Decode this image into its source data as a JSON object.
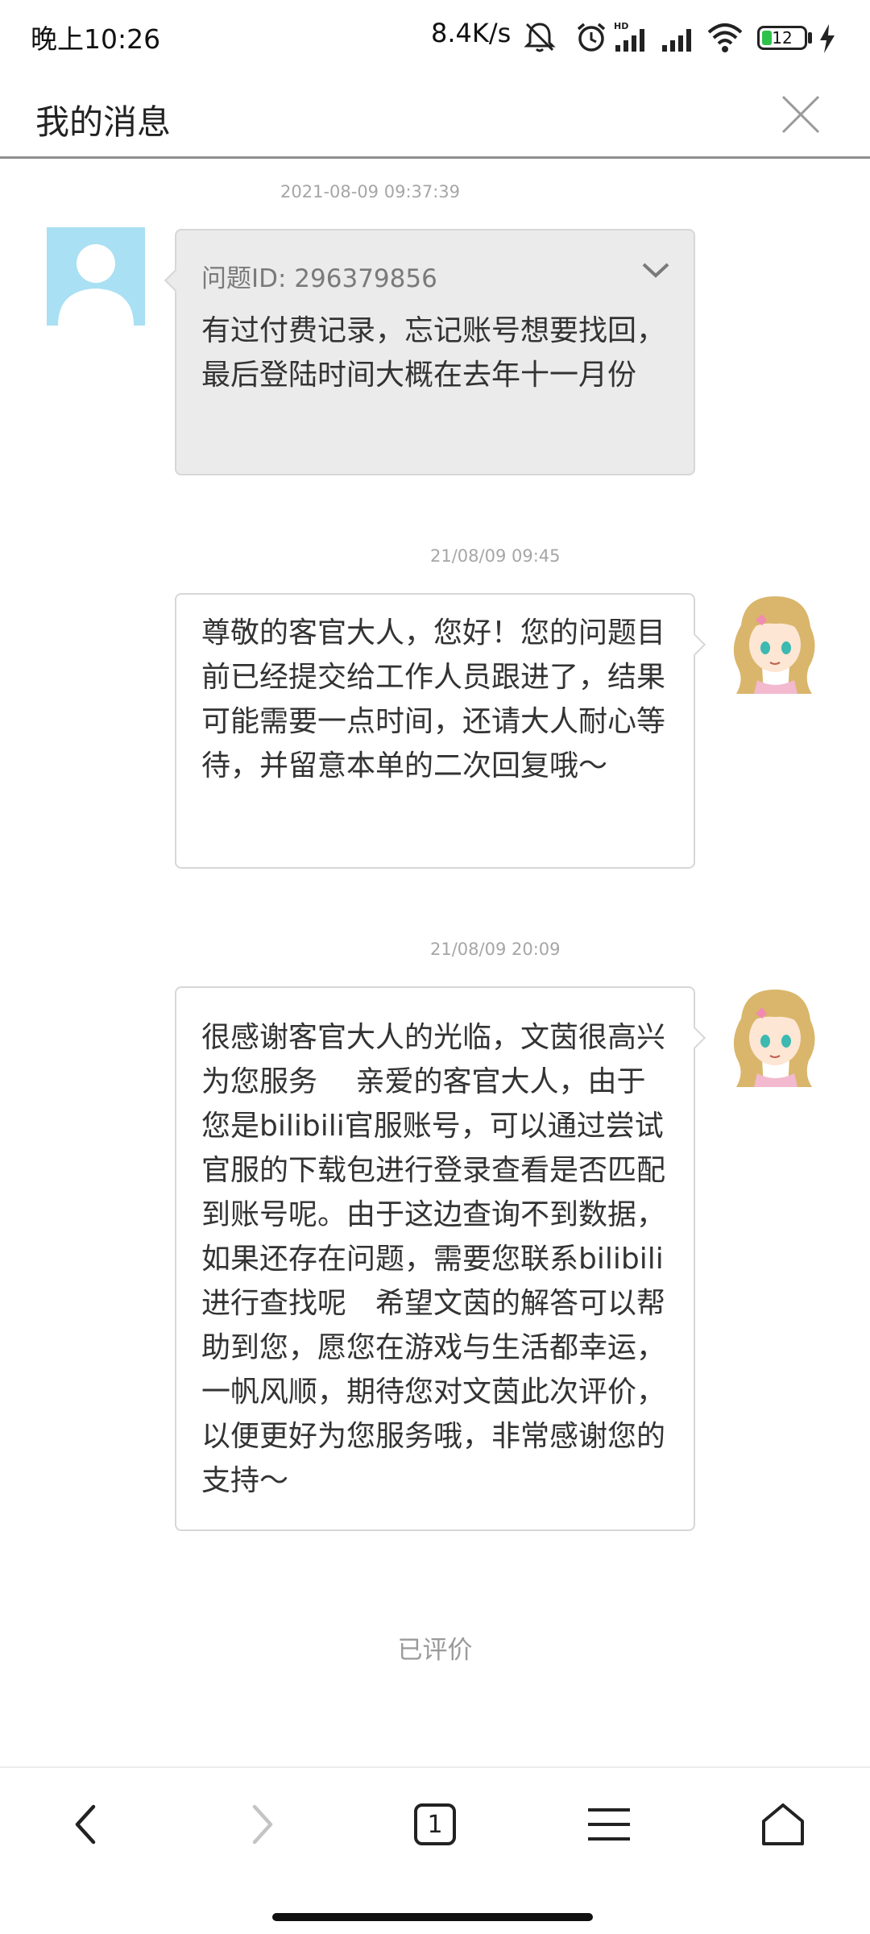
{
  "status_bar": {
    "time": "晚上10:26",
    "net_speed": "8.4K/s",
    "battery_level": "12",
    "icons": [
      "mute-icon",
      "alarm-icon",
      "hd-signal-icon",
      "signal-icon",
      "wifi-icon",
      "battery-icon",
      "charging-icon"
    ]
  },
  "header": {
    "title": "我的消息",
    "close_icon": "close-icon"
  },
  "messages": [
    {
      "timestamp": "2021-08-09 09:37:39",
      "sender": "user",
      "question_id": "问题ID: 296379856",
      "text": "有过付费记录，忘记账号想要找回，最后登陆时间大概在去年十一月份"
    },
    {
      "timestamp": "21/08/09 09:45",
      "sender": "cs",
      "text": "尊敬的客官大人，您好！您的问题目前已经提交给工作人员跟进了，结果可能需要一点时间，还请大人耐心等待，并留意本单的二次回复哦～"
    },
    {
      "timestamp": "21/08/09 20:09",
      "sender": "cs",
      "text": "很感谢客官大人的光临，文茵很高兴为您服务　 亲爱的客官大人，由于您是bilibili官服账号，可以通过尝试官服的下载包进行登录查看是否匹配到账号呢。由于这边查询不到数据，如果还存在问题，需要您联系bilibili进行查找呢　希望文茵的解答可以帮助到您，愿您在游戏与生活都幸运，一帆风顺，期待您对文茵此次评价，以便更好为您服务哦，非常感谢您的支持～"
    }
  ],
  "rated_label": "已评价",
  "bottom_nav": {
    "tab_count": "1",
    "items": [
      "back-icon",
      "forward-icon",
      "tabs-icon",
      "menu-icon",
      "home-icon"
    ]
  },
  "colors": {
    "battery": "#2ec24a",
    "user_avatar_bg": "#a9e0f3",
    "user_bubble_bg": "#ebebeb",
    "divider": "#8f8f8f"
  }
}
